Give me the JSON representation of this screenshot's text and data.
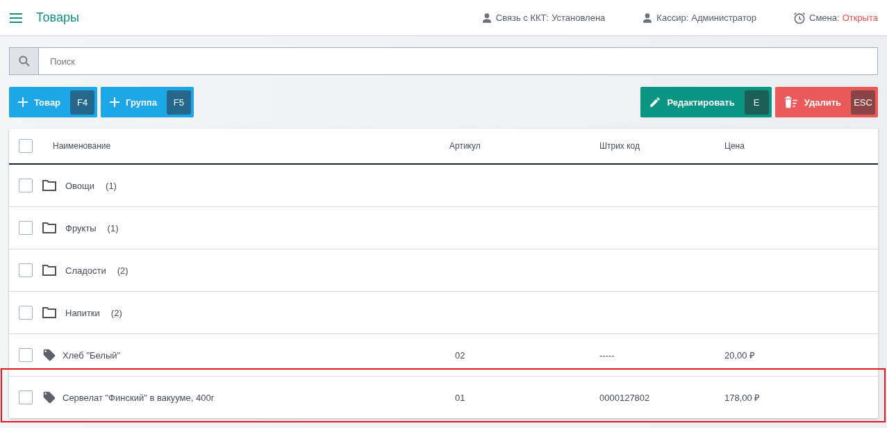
{
  "header": {
    "title": "Товары",
    "status": [
      {
        "kind": "connection",
        "label": "Связь с ККТ:",
        "value": "Установлена"
      },
      {
        "kind": "cashier",
        "label": "Кассир:",
        "value": "Администратор"
      },
      {
        "kind": "shift",
        "label": "Смена:",
        "value": "Открыта"
      }
    ]
  },
  "search": {
    "placeholder": "Поиск"
  },
  "toolbar": {
    "left": [
      {
        "kind": "add",
        "label": "Товар",
        "key": "F4"
      },
      {
        "kind": "add",
        "label": "Группа",
        "key": "F5"
      }
    ],
    "right": [
      {
        "kind": "edit",
        "label": "Редактировать",
        "key": "E"
      },
      {
        "kind": "delete",
        "label": "Удалить",
        "key": "ESC"
      }
    ]
  },
  "table": {
    "all_checked": false,
    "columns": [
      "Наименование",
      "Артикул",
      "Штрих код",
      "Цена"
    ],
    "rows": [
      {
        "kind": "group",
        "name": "Овощи",
        "count": "(1)",
        "checked": false,
        "highlighted": false
      },
      {
        "kind": "group",
        "name": "Фрукты",
        "count": "(1)",
        "checked": false,
        "highlighted": false
      },
      {
        "kind": "group",
        "name": "Сладости",
        "count": "(2)",
        "checked": false,
        "highlighted": false
      },
      {
        "kind": "group",
        "name": "Напитки",
        "count": "(2)",
        "checked": false,
        "highlighted": false
      },
      {
        "kind": "product",
        "name": "Хлеб \"Белый\"",
        "article": "02",
        "barcode": "-----",
        "price": "20,00 ₽",
        "checked": false,
        "highlighted": false
      },
      {
        "kind": "product",
        "name": "Сервелат \"Финский\" в вакууме, 400г",
        "article": "01",
        "barcode": "0000127802",
        "price": "178,00 ₽",
        "checked": false,
        "highlighted": true
      }
    ]
  }
}
